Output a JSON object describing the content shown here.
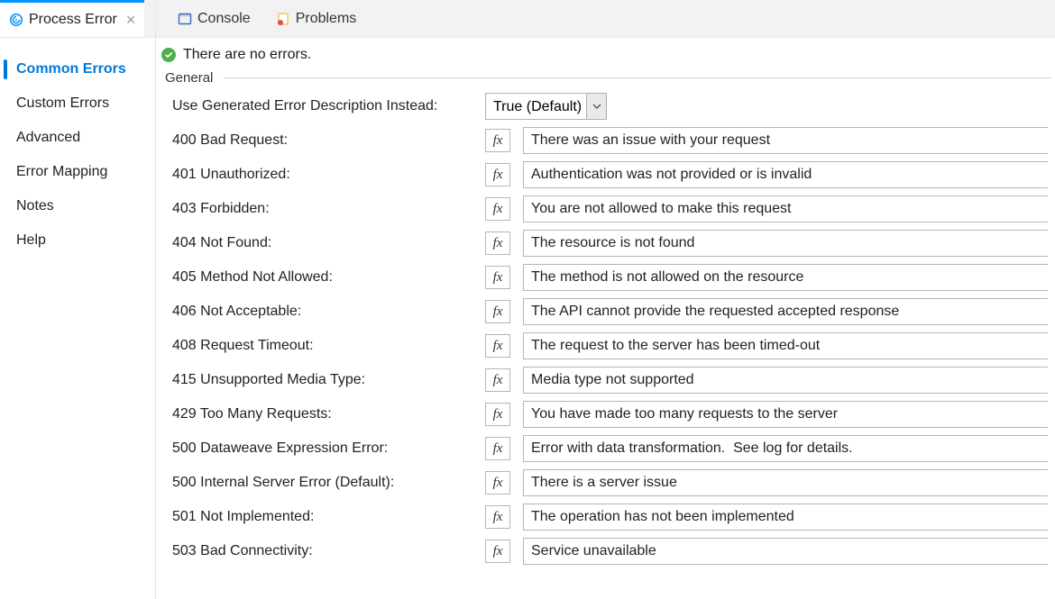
{
  "tabs": {
    "process_error": {
      "label": "Process Error"
    },
    "console": {
      "label": "Console"
    },
    "problems": {
      "label": "Problems"
    }
  },
  "sidenav": {
    "items": [
      {
        "label": "Common Errors",
        "selected": true
      },
      {
        "label": "Custom Errors",
        "selected": false
      },
      {
        "label": "Advanced",
        "selected": false
      },
      {
        "label": "Error Mapping",
        "selected": false
      },
      {
        "label": "Notes",
        "selected": false
      },
      {
        "label": "Help",
        "selected": false
      }
    ]
  },
  "status": {
    "text": "There are no errors."
  },
  "group": {
    "title": "General",
    "use_generated": {
      "label": "Use Generated Error Description Instead:",
      "value": "True (Default)"
    },
    "rows": [
      {
        "label": "400 Bad Request:",
        "value": "There was an issue with your request"
      },
      {
        "label": "401 Unauthorized:",
        "value": "Authentication was not provided or is invalid"
      },
      {
        "label": "403 Forbidden:",
        "value": "You are not allowed to make this request"
      },
      {
        "label": "404 Not Found:",
        "value": "The resource is not found"
      },
      {
        "label": "405 Method Not Allowed:",
        "value": "The method is not allowed on the resource"
      },
      {
        "label": "406 Not Acceptable:",
        "value": "The API cannot provide the requested accepted response"
      },
      {
        "label": "408 Request Timeout:",
        "value": "The request to the server has been timed-out"
      },
      {
        "label": "415 Unsupported Media Type:",
        "value": "Media type not supported"
      },
      {
        "label": "429 Too Many Requests:",
        "value": "You have made too many requests to the server"
      },
      {
        "label": "500 Dataweave Expression Error:",
        "value": "Error with data transformation.  See log for details."
      },
      {
        "label": "500 Internal Server Error (Default):",
        "value": "There is a server issue"
      },
      {
        "label": "501 Not Implemented:",
        "value": "The operation has not been implemented"
      },
      {
        "label": "503 Bad Connectivity:",
        "value": "Service unavailable"
      }
    ]
  },
  "fx_label": "fx"
}
